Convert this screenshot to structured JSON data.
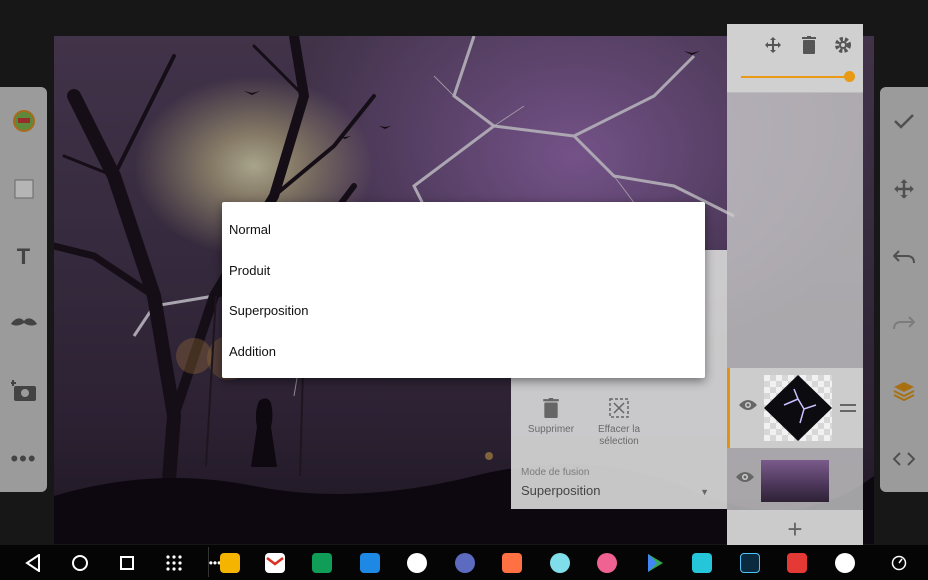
{
  "dropdown": {
    "items": [
      "Normal",
      "Produit",
      "Superposition",
      "Addition"
    ]
  },
  "layer_properties": {
    "delete_label": "Supprimer",
    "clear_selection_label_line1": "Effacer la",
    "clear_selection_label_line2": "sélection",
    "blend_mode_label": "Mode de fusion",
    "blend_mode_value": "Superposition"
  },
  "layers_panel": {
    "opacity_percent": 100,
    "accent_color": "#e89a14",
    "layers": [
      {
        "name": "lightning-layer",
        "visible": true,
        "active": true
      },
      {
        "name": "background-layer",
        "visible": true,
        "active": false
      }
    ]
  },
  "left_toolbar": {
    "tools": [
      "sticker-icon",
      "square-icon",
      "text-icon",
      "mustache-icon",
      "add-photo-icon",
      "more-icon"
    ]
  },
  "right_toolbar": {
    "tools": [
      "check-icon",
      "move-icon",
      "undo-icon",
      "redo-icon",
      "layers-icon",
      "code-icon"
    ]
  },
  "taskbar": {
    "nav": [
      "back-icon",
      "home-icon",
      "recents-icon",
      "apps-grid-icon"
    ],
    "apps": [
      "keep",
      "gmail",
      "sheets",
      "files",
      "camera",
      "settings",
      "app-orange",
      "app-teal",
      "app-chat",
      "play-store",
      "app-m",
      "photoshop",
      "acrobat",
      "voice"
    ]
  }
}
